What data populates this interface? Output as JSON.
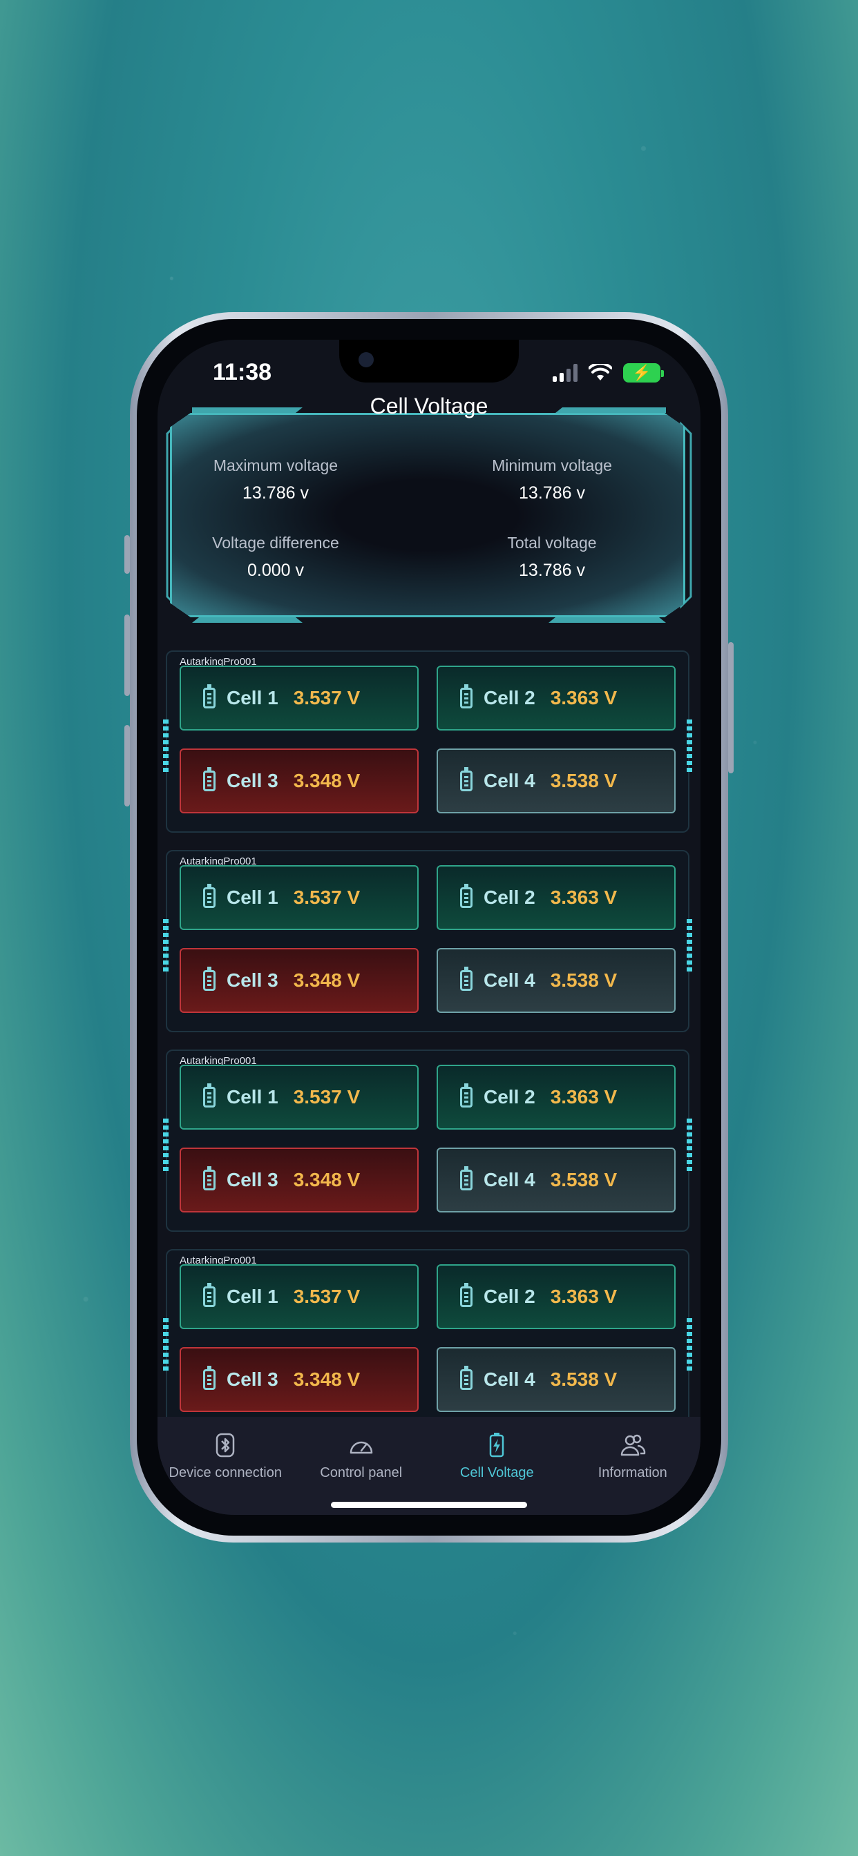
{
  "status_bar": {
    "time": "11:38",
    "battery_glyph": "⚡"
  },
  "header": {
    "title": "Cell Voltage"
  },
  "summary": {
    "max_label": "Maximum voltage",
    "max_value": "13.786 v",
    "min_label": "Minimum voltage",
    "min_value": "13.786 v",
    "diff_label": "Voltage difference",
    "diff_value": "0.000 v",
    "total_label": "Total voltage",
    "total_value": "13.786 v"
  },
  "groups": [
    {
      "name": "AutarkingPro001",
      "cells": [
        {
          "name": "Cell 1",
          "value": "3.537 V",
          "state": "green"
        },
        {
          "name": "Cell 2",
          "value": "3.363 V",
          "state": "green"
        },
        {
          "name": "Cell 3",
          "value": "3.348 V",
          "state": "red"
        },
        {
          "name": "Cell 4",
          "value": "3.538 V",
          "state": "gray"
        }
      ]
    },
    {
      "name": "AutarkingPro001",
      "cells": [
        {
          "name": "Cell 1",
          "value": "3.537 V",
          "state": "green"
        },
        {
          "name": "Cell 2",
          "value": "3.363 V",
          "state": "green"
        },
        {
          "name": "Cell 3",
          "value": "3.348 V",
          "state": "red"
        },
        {
          "name": "Cell 4",
          "value": "3.538 V",
          "state": "gray"
        }
      ]
    },
    {
      "name": "AutarkingPro001",
      "cells": [
        {
          "name": "Cell 1",
          "value": "3.537 V",
          "state": "green"
        },
        {
          "name": "Cell 2",
          "value": "3.363 V",
          "state": "green"
        },
        {
          "name": "Cell 3",
          "value": "3.348 V",
          "state": "red"
        },
        {
          "name": "Cell 4",
          "value": "3.538 V",
          "state": "gray"
        }
      ]
    },
    {
      "name": "AutarkingPro001",
      "cells": [
        {
          "name": "Cell 1",
          "value": "3.537 V",
          "state": "green"
        },
        {
          "name": "Cell 2",
          "value": "3.363 V",
          "state": "green"
        },
        {
          "name": "Cell 3",
          "value": "3.348 V",
          "state": "red"
        },
        {
          "name": "Cell 4",
          "value": "3.538 V",
          "state": "gray"
        }
      ]
    }
  ],
  "tabs": [
    {
      "label": "Device connection",
      "icon": "bluetooth-icon",
      "active": false
    },
    {
      "label": "Control panel",
      "icon": "gauge-icon",
      "active": false
    },
    {
      "label": "Cell Voltage",
      "icon": "battery-charge-icon",
      "active": true
    },
    {
      "label": "Information",
      "icon": "users-icon",
      "active": false
    }
  ],
  "colors": {
    "accent": "#4fc6d6",
    "value": "#f2b84c",
    "ok": "#2fa58a",
    "warn": "#c0353a"
  }
}
